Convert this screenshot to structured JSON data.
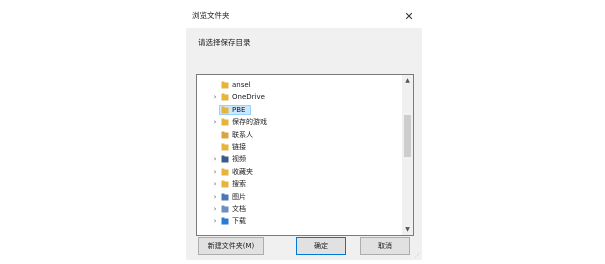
{
  "dialog": {
    "title": "浏览文件夹",
    "close_glyph": "✕",
    "prompt": "请选择保存目录",
    "tree": [
      {
        "label": "ansel",
        "icon": "folder-icon",
        "color": "#e8b33a",
        "expandable": false,
        "selected": false
      },
      {
        "label": "OneDrive",
        "icon": "folder-icon",
        "color": "#e8b33a",
        "expandable": true,
        "selected": false
      },
      {
        "label": "PBE",
        "icon": "folder-icon",
        "color": "#e8b33a",
        "expandable": false,
        "selected": true
      },
      {
        "label": "保存的游戏",
        "icon": "saved-games-icon",
        "color": "#e8b33a",
        "expandable": true,
        "selected": false
      },
      {
        "label": "联系人",
        "icon": "contacts-icon",
        "color": "#d9a441",
        "expandable": false,
        "selected": false
      },
      {
        "label": "链接",
        "icon": "links-icon",
        "color": "#e8b33a",
        "expandable": false,
        "selected": false
      },
      {
        "label": "视频",
        "icon": "videos-icon",
        "color": "#3b5a8a",
        "expandable": true,
        "selected": false
      },
      {
        "label": "收藏夹",
        "icon": "favorites-icon",
        "color": "#e8b33a",
        "expandable": true,
        "selected": false
      },
      {
        "label": "搜索",
        "icon": "search-folder-icon",
        "color": "#e8b33a",
        "expandable": true,
        "selected": false
      },
      {
        "label": "图片",
        "icon": "pictures-icon",
        "color": "#4a78b5",
        "expandable": true,
        "selected": false
      },
      {
        "label": "文档",
        "icon": "documents-icon",
        "color": "#6b8fc4",
        "expandable": true,
        "selected": false
      },
      {
        "label": "下载",
        "icon": "downloads-icon",
        "color": "#2a7ad5",
        "expandable": true,
        "selected": false
      }
    ],
    "chevron_glyph": "›",
    "scroll_up_glyph": "▲",
    "scroll_down_glyph": "▼",
    "buttons": {
      "new_folder": "新建文件夹(M)",
      "ok": "确定",
      "cancel": "取消"
    }
  }
}
